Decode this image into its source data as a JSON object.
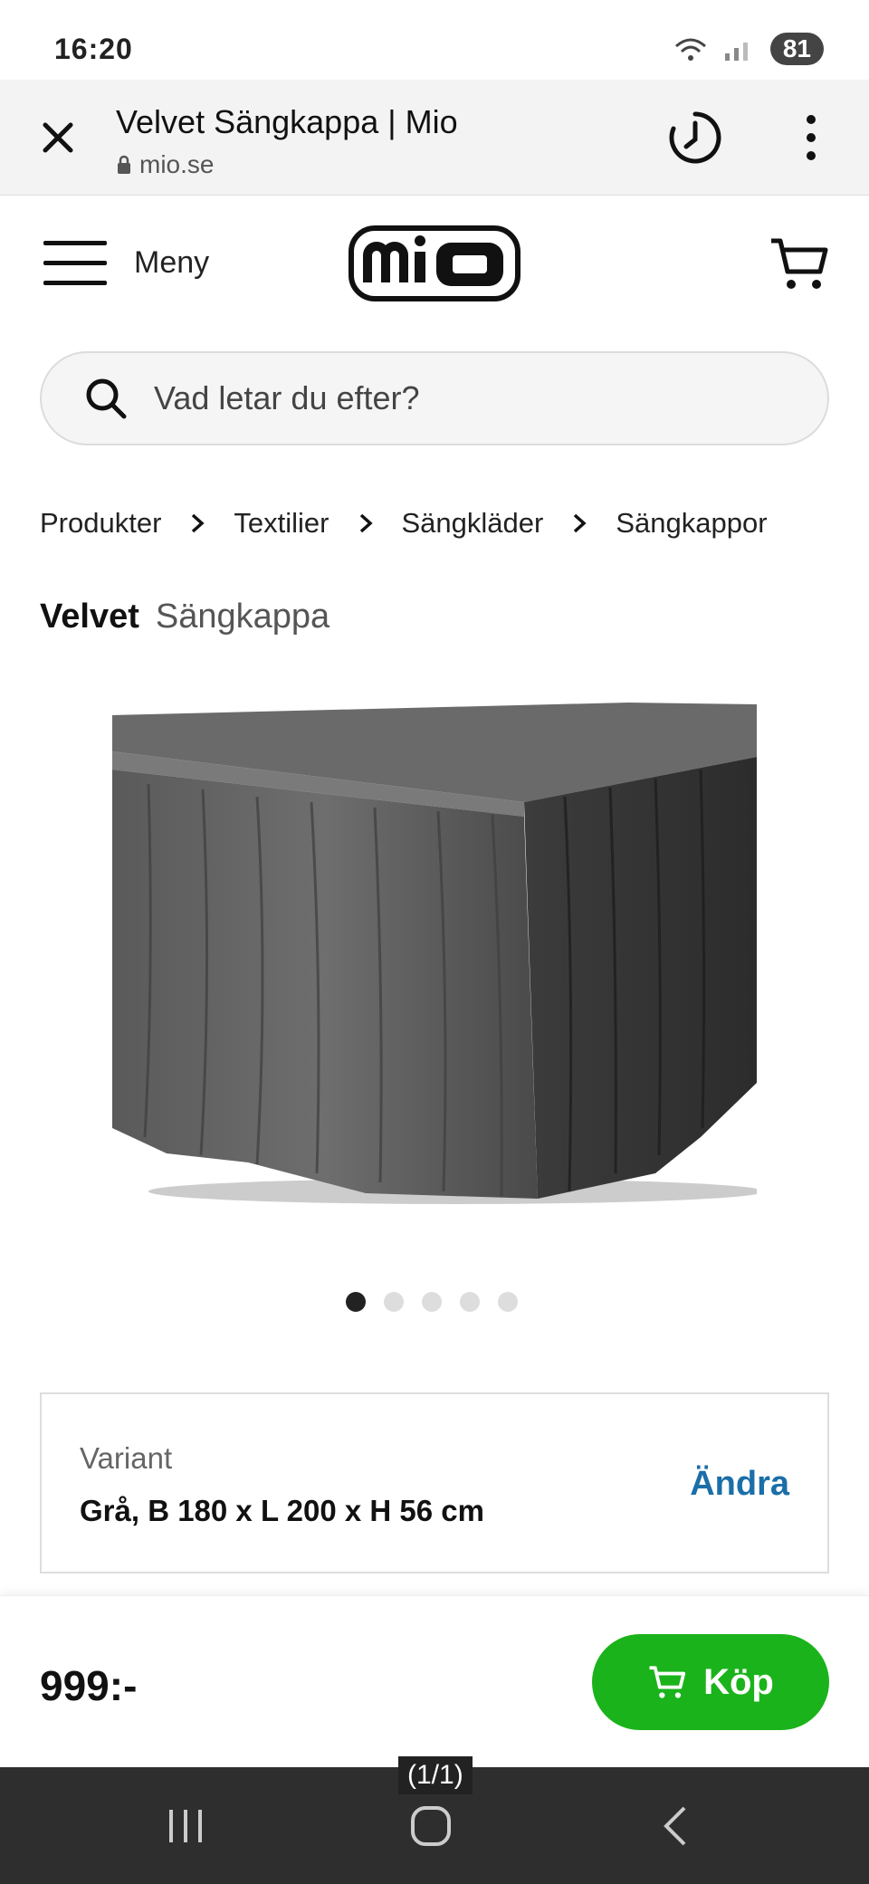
{
  "status_bar": {
    "time": "16:20",
    "battery": "81"
  },
  "browser": {
    "title": "Velvet Sängkappa | Mio",
    "url": "mio.se"
  },
  "header": {
    "menu_label": "Meny",
    "logo_text": "mio"
  },
  "search": {
    "placeholder": "Vad letar du efter?"
  },
  "breadcrumb": [
    "Produkter",
    "Textilier",
    "Sängkläder",
    "Sängkappor"
  ],
  "product": {
    "brand": "Velvet",
    "type": "Sängkappa",
    "image_count": 5,
    "active_image": 1
  },
  "variant": {
    "label": "Variant",
    "value": "Grå, B 180 x L 200 x H 56 cm",
    "change_label": "Ändra"
  },
  "buy": {
    "price": "999:-",
    "button_label": "Köp"
  },
  "pager": "(1/1)",
  "colors": {
    "buy_green": "#1bb31b",
    "link_blue": "#1b6ea8",
    "nav_dark": "#2e2e2e"
  }
}
